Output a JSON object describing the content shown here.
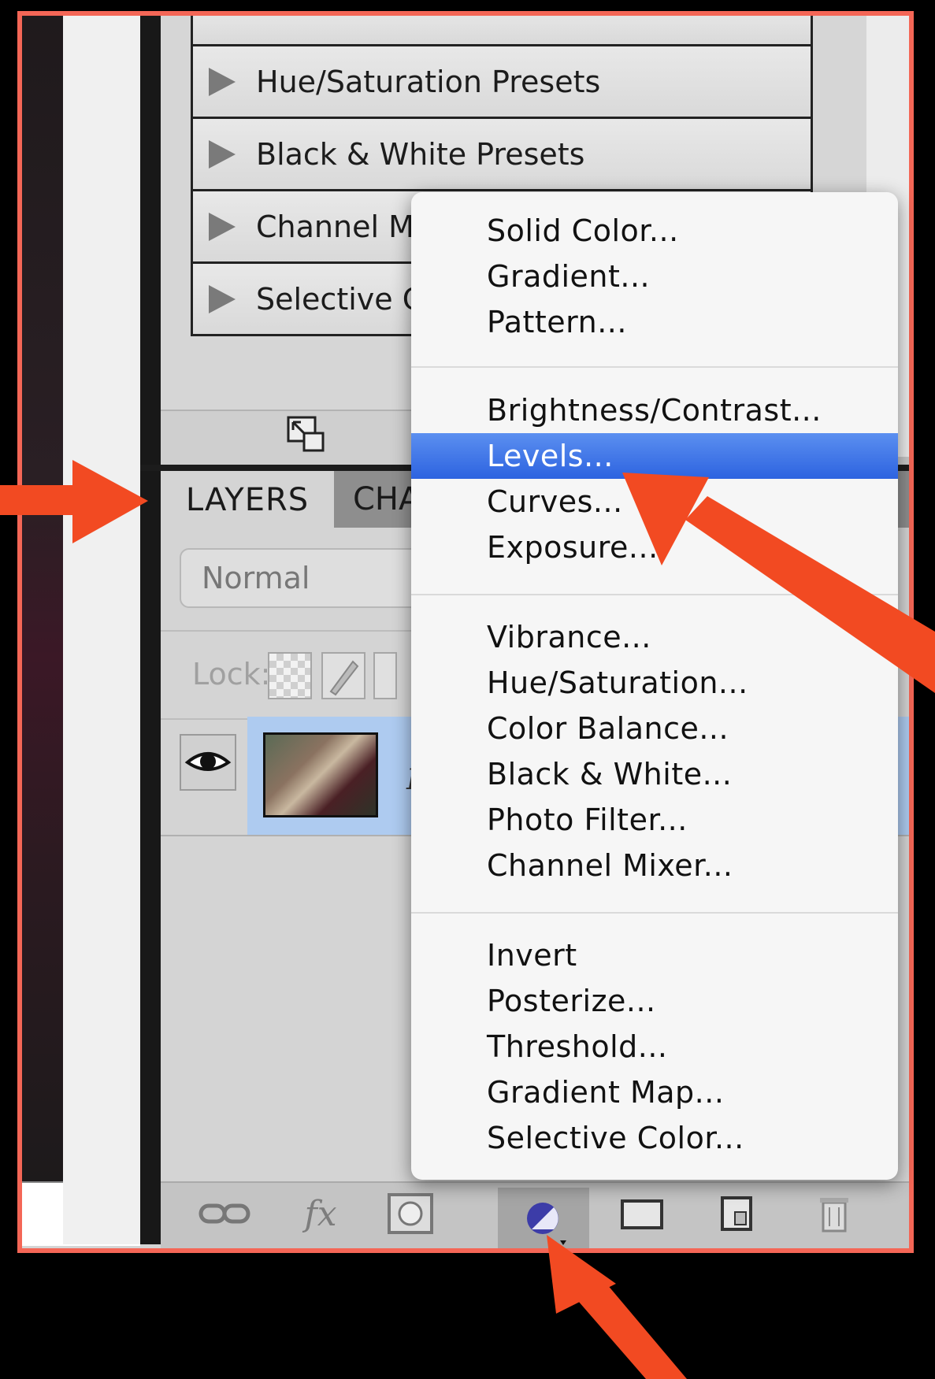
{
  "presets": [
    {
      "label": "Hue/Saturation Presets"
    },
    {
      "label": "Black & White Presets"
    },
    {
      "label": "Channel M"
    },
    {
      "label": "Selective C"
    }
  ],
  "layers_panel": {
    "tab_layers": "LAYERS",
    "tab_channels": "CHA",
    "blend_mode": "Normal",
    "lock_label": "Lock:",
    "layer_name": "Ba"
  },
  "menu": {
    "group1": [
      "Solid Color...",
      "Gradient...",
      "Pattern..."
    ],
    "group2": [
      "Brightness/Contrast...",
      "Levels...",
      "Curves...",
      "Exposure..."
    ],
    "group3": [
      "Vibrance...",
      "Hue/Saturation...",
      "Color Balance...",
      "Black & White...",
      "Photo Filter...",
      "Channel Mixer..."
    ],
    "group4": [
      "Invert",
      "Posterize...",
      "Threshold...",
      "Gradient Map...",
      "Selective Color..."
    ],
    "selected": "Levels..."
  },
  "icons": {
    "link": "link-layers-icon",
    "fx": "fx-icon",
    "mask": "mask-icon",
    "adjustment": "new-adjustment-layer-icon",
    "group": "folder-icon",
    "new_layer": "new-layer-icon",
    "trash": "trash-icon"
  },
  "fx_label": "fx",
  "colors": {
    "frame": "#f46656",
    "arrow": "#f24a22",
    "menu_highlight": "#3a70e6",
    "selected_layer": "#aecbf0"
  }
}
